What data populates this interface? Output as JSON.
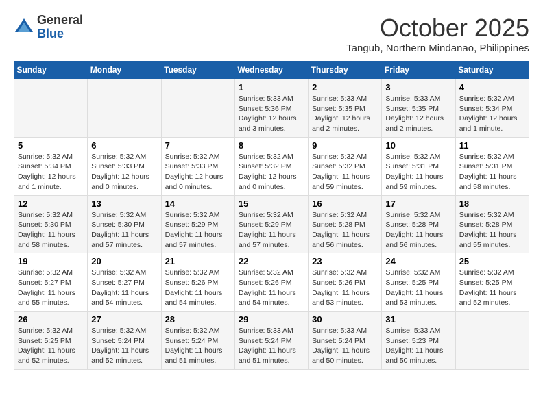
{
  "header": {
    "logo": {
      "general": "General",
      "blue": "Blue"
    },
    "title": "October 2025",
    "location": "Tangub, Northern Mindanao, Philippines"
  },
  "calendar": {
    "days_of_week": [
      "Sunday",
      "Monday",
      "Tuesday",
      "Wednesday",
      "Thursday",
      "Friday",
      "Saturday"
    ],
    "weeks": [
      [
        {
          "day": "",
          "info": ""
        },
        {
          "day": "",
          "info": ""
        },
        {
          "day": "",
          "info": ""
        },
        {
          "day": "1",
          "info": "Sunrise: 5:33 AM\nSunset: 5:36 PM\nDaylight: 12 hours and 3 minutes."
        },
        {
          "day": "2",
          "info": "Sunrise: 5:33 AM\nSunset: 5:35 PM\nDaylight: 12 hours and 2 minutes."
        },
        {
          "day": "3",
          "info": "Sunrise: 5:33 AM\nSunset: 5:35 PM\nDaylight: 12 hours and 2 minutes."
        },
        {
          "day": "4",
          "info": "Sunrise: 5:32 AM\nSunset: 5:34 PM\nDaylight: 12 hours and 1 minute."
        }
      ],
      [
        {
          "day": "5",
          "info": "Sunrise: 5:32 AM\nSunset: 5:34 PM\nDaylight: 12 hours and 1 minute."
        },
        {
          "day": "6",
          "info": "Sunrise: 5:32 AM\nSunset: 5:33 PM\nDaylight: 12 hours and 0 minutes."
        },
        {
          "day": "7",
          "info": "Sunrise: 5:32 AM\nSunset: 5:33 PM\nDaylight: 12 hours and 0 minutes."
        },
        {
          "day": "8",
          "info": "Sunrise: 5:32 AM\nSunset: 5:32 PM\nDaylight: 12 hours and 0 minutes."
        },
        {
          "day": "9",
          "info": "Sunrise: 5:32 AM\nSunset: 5:32 PM\nDaylight: 11 hours and 59 minutes."
        },
        {
          "day": "10",
          "info": "Sunrise: 5:32 AM\nSunset: 5:31 PM\nDaylight: 11 hours and 59 minutes."
        },
        {
          "day": "11",
          "info": "Sunrise: 5:32 AM\nSunset: 5:31 PM\nDaylight: 11 hours and 58 minutes."
        }
      ],
      [
        {
          "day": "12",
          "info": "Sunrise: 5:32 AM\nSunset: 5:30 PM\nDaylight: 11 hours and 58 minutes."
        },
        {
          "day": "13",
          "info": "Sunrise: 5:32 AM\nSunset: 5:30 PM\nDaylight: 11 hours and 57 minutes."
        },
        {
          "day": "14",
          "info": "Sunrise: 5:32 AM\nSunset: 5:29 PM\nDaylight: 11 hours and 57 minutes."
        },
        {
          "day": "15",
          "info": "Sunrise: 5:32 AM\nSunset: 5:29 PM\nDaylight: 11 hours and 57 minutes."
        },
        {
          "day": "16",
          "info": "Sunrise: 5:32 AM\nSunset: 5:28 PM\nDaylight: 11 hours and 56 minutes."
        },
        {
          "day": "17",
          "info": "Sunrise: 5:32 AM\nSunset: 5:28 PM\nDaylight: 11 hours and 56 minutes."
        },
        {
          "day": "18",
          "info": "Sunrise: 5:32 AM\nSunset: 5:28 PM\nDaylight: 11 hours and 55 minutes."
        }
      ],
      [
        {
          "day": "19",
          "info": "Sunrise: 5:32 AM\nSunset: 5:27 PM\nDaylight: 11 hours and 55 minutes."
        },
        {
          "day": "20",
          "info": "Sunrise: 5:32 AM\nSunset: 5:27 PM\nDaylight: 11 hours and 54 minutes."
        },
        {
          "day": "21",
          "info": "Sunrise: 5:32 AM\nSunset: 5:26 PM\nDaylight: 11 hours and 54 minutes."
        },
        {
          "day": "22",
          "info": "Sunrise: 5:32 AM\nSunset: 5:26 PM\nDaylight: 11 hours and 54 minutes."
        },
        {
          "day": "23",
          "info": "Sunrise: 5:32 AM\nSunset: 5:26 PM\nDaylight: 11 hours and 53 minutes."
        },
        {
          "day": "24",
          "info": "Sunrise: 5:32 AM\nSunset: 5:25 PM\nDaylight: 11 hours and 53 minutes."
        },
        {
          "day": "25",
          "info": "Sunrise: 5:32 AM\nSunset: 5:25 PM\nDaylight: 11 hours and 52 minutes."
        }
      ],
      [
        {
          "day": "26",
          "info": "Sunrise: 5:32 AM\nSunset: 5:25 PM\nDaylight: 11 hours and 52 minutes."
        },
        {
          "day": "27",
          "info": "Sunrise: 5:32 AM\nSunset: 5:24 PM\nDaylight: 11 hours and 52 minutes."
        },
        {
          "day": "28",
          "info": "Sunrise: 5:32 AM\nSunset: 5:24 PM\nDaylight: 11 hours and 51 minutes."
        },
        {
          "day": "29",
          "info": "Sunrise: 5:33 AM\nSunset: 5:24 PM\nDaylight: 11 hours and 51 minutes."
        },
        {
          "day": "30",
          "info": "Sunrise: 5:33 AM\nSunset: 5:24 PM\nDaylight: 11 hours and 50 minutes."
        },
        {
          "day": "31",
          "info": "Sunrise: 5:33 AM\nSunset: 5:23 PM\nDaylight: 11 hours and 50 minutes."
        },
        {
          "day": "",
          "info": ""
        }
      ]
    ]
  }
}
